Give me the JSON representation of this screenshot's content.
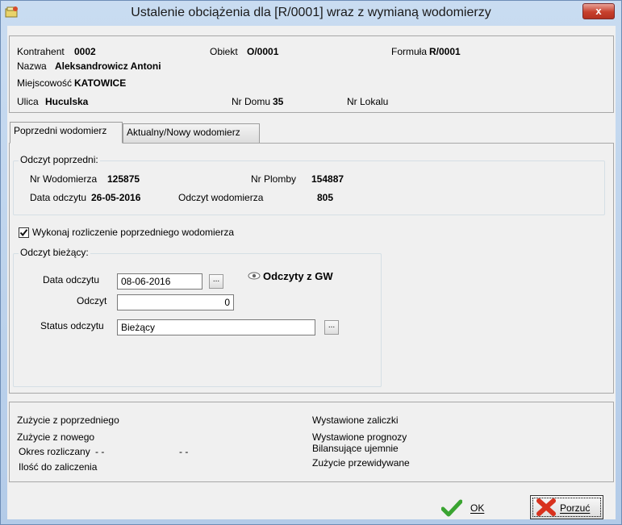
{
  "window": {
    "title": "Ustalenie obciążenia dla [R/0001] wraz z wymianą wodomierzy",
    "close_label": "x"
  },
  "header": {
    "kontrahent_label": "Kontrahent",
    "kontrahent_value": "0002",
    "obiekt_label": "Obiekt",
    "obiekt_value": "O/0001",
    "formula_label": "Formuła",
    "formula_value": "R/0001",
    "nazwa_label": "Nazwa",
    "nazwa_value": "Aleksandrowicz Antoni",
    "miejscowosc_label": "Miejscowość",
    "miejscowosc_value": "KATOWICE",
    "ulica_label": "Ulica",
    "ulica_value": "Huculska",
    "nr_domu_label": "Nr Domu",
    "nr_domu_value": "35",
    "nr_lokalu_label": "Nr Lokalu"
  },
  "tabs": [
    {
      "label": "Poprzedni wodomierz",
      "active": true
    },
    {
      "label": "Aktualny/Nowy wodomierz",
      "active": false
    }
  ],
  "previous_reading": {
    "title": "Odczyt poprzedni:",
    "nr_wodomierza_label": "Nr Wodomierza",
    "nr_wodomierza_value": "125875",
    "nr_plomby_label": "Nr Plomby",
    "nr_plomby_value": "154887",
    "data_label": "Data odczytu",
    "data_value": "26-05-2016",
    "odczyt_label": "Odczyt wodomierza",
    "odczyt_value": "805"
  },
  "settle_checkbox": {
    "label": "Wykonaj rozliczenie poprzedniego wodomierza",
    "checked": true
  },
  "current_reading": {
    "title": "Odczyt bieżący:",
    "data_label": "Data odczytu",
    "data_value": "08-06-2016",
    "odczyt_label": "Odczyt",
    "odczyt_value": "0",
    "status_label": "Status odczytu",
    "status_value": "Bieżący",
    "ellipsis": "...",
    "gw_label": "Odczyty z GW"
  },
  "summary": {
    "zuzycie_poprzedniego": "Zużycie z poprzedniego",
    "zuzycie_nowego": "Zużycie z nowego",
    "okres_label": "Okres rozliczany",
    "okres_from": "- -",
    "okres_to": "- -",
    "ilosc": "Ilość do zaliczenia",
    "wystawione_zaliczki": "Wystawione zaliczki",
    "wystawione_prognozy": "Wystawione prognozy",
    "bilansujace": "Bilansujące ujemnie",
    "zuzycie_przewidywane": "Zużycie przewidywane"
  },
  "buttons": {
    "ok_label": "OK",
    "cancel_label": "Porzuć"
  },
  "icons": [
    "app-icon",
    "close-icon",
    "eye-icon",
    "checkmark-icon",
    "x-cross-icon"
  ],
  "colors": {
    "ok_green": "#3aa431",
    "cancel_red": "#d8321e",
    "titlebar": "#bcd3ec"
  }
}
